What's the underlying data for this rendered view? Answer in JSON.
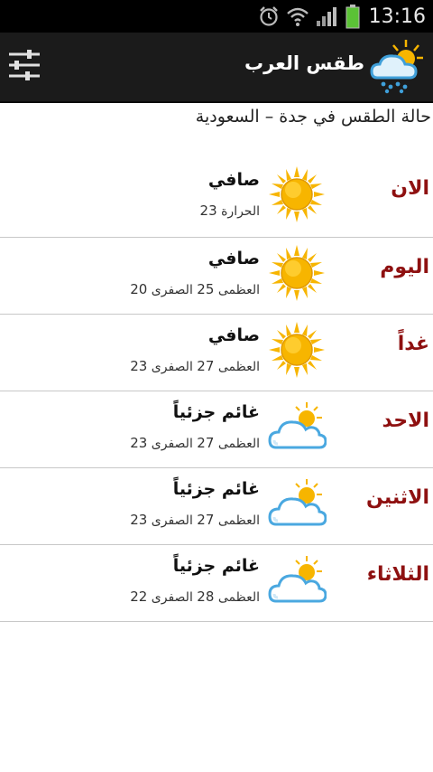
{
  "status_bar": {
    "time": "13:16"
  },
  "app": {
    "title": "طقس العرب"
  },
  "location": "حالة الطقس في جدة – السعودية",
  "labels": {
    "max": "العظمى",
    "min": "الصفرى",
    "temp": "الحرارة"
  },
  "now": {
    "day": "الان",
    "condition": "صافي",
    "temp": "23",
    "icon": "sun-icon"
  },
  "forecast": [
    {
      "day": "اليوم",
      "condition": "صافي",
      "max": "25",
      "min": "20",
      "icon": "sun-icon"
    },
    {
      "day": "غداً",
      "condition": "صافي",
      "max": "27",
      "min": "23",
      "icon": "sun-icon"
    },
    {
      "day": "الاحد",
      "condition": "غائم جزئياً",
      "max": "27",
      "min": "23",
      "icon": "partly-cloudy-icon"
    },
    {
      "day": "الاثنين",
      "condition": "غائم جزئياً",
      "max": "27",
      "min": "23",
      "icon": "partly-cloudy-icon"
    },
    {
      "day": "الثلاثاء",
      "condition": "غائم جزئياً",
      "max": "28",
      "min": "22",
      "icon": "partly-cloudy-icon"
    }
  ],
  "colors": {
    "day_label": "#8e1010",
    "sun": "#f7b500",
    "cloud_outline": "#4aa8e0",
    "action_bar": "#1b1b1b"
  }
}
